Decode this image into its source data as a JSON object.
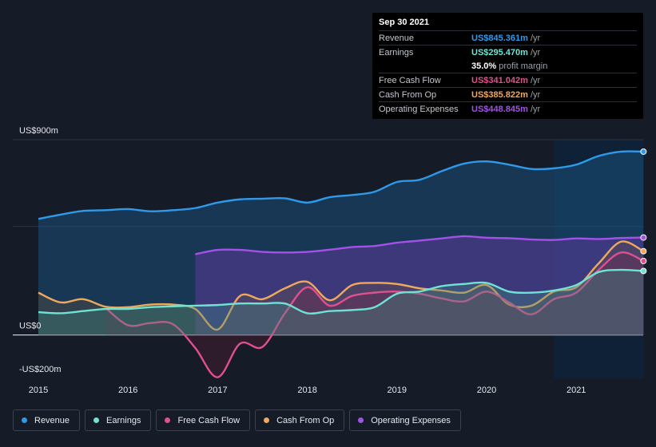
{
  "tooltip": {
    "date": "Sep 30 2021",
    "rows": [
      {
        "label": "Revenue",
        "value": "US$845.361m",
        "unit": "/yr",
        "color": "#2f9ae9"
      },
      {
        "label": "Earnings",
        "value": "US$295.470m",
        "unit": "/yr",
        "color": "#6fe3d3"
      },
      {
        "label": "",
        "value": "35.0%",
        "unit": "profit margin",
        "color": "#ffffff"
      },
      {
        "label": "Free Cash Flow",
        "value": "US$341.042m",
        "unit": "/yr",
        "color": "#e0508f"
      },
      {
        "label": "Cash From Op",
        "value": "US$385.822m",
        "unit": "/yr",
        "color": "#f0a95c"
      },
      {
        "label": "Operating Expenses",
        "value": "US$448.845m",
        "unit": "/yr",
        "color": "#a351e8"
      }
    ]
  },
  "legend": [
    {
      "label": "Revenue",
      "color": "#2f9ae9"
    },
    {
      "label": "Earnings",
      "color": "#6fe3d3"
    },
    {
      "label": "Free Cash Flow",
      "color": "#e0508f"
    },
    {
      "label": "Cash From Op",
      "color": "#f0a95c"
    },
    {
      "label": "Operating Expenses",
      "color": "#a351e8"
    }
  ],
  "chart_data": {
    "type": "line",
    "ylim": [
      -200,
      900
    ],
    "xlim": [
      2014.7,
      2021.75
    ],
    "y_tick_labels": [
      {
        "value": 900,
        "label": "US$900m"
      },
      {
        "value": 0,
        "label": "US$0"
      },
      {
        "value": -200,
        "label": "-US$200m"
      }
    ],
    "x_ticks": [
      2015,
      2016,
      2017,
      2018,
      2019,
      2020,
      2021
    ],
    "x_tick_labels": [
      "2015",
      "2016",
      "2017",
      "2018",
      "2019",
      "2020",
      "2021"
    ],
    "grid_values": [
      900,
      500,
      0
    ],
    "highlight_from": 2020.75,
    "series": [
      {
        "name": "Revenue",
        "color": "#2f9ae9",
        "fill": true,
        "x": [
          2015.0,
          2015.25,
          2015.5,
          2015.75,
          2016.0,
          2016.25,
          2016.5,
          2016.75,
          2017.0,
          2017.25,
          2017.5,
          2017.75,
          2018.0,
          2018.25,
          2018.5,
          2018.75,
          2019.0,
          2019.25,
          2019.5,
          2019.75,
          2020.0,
          2020.25,
          2020.5,
          2020.75,
          2021.0,
          2021.25,
          2021.5,
          2021.75
        ],
        "y": [
          535,
          555,
          572,
          575,
          580,
          570,
          575,
          585,
          610,
          625,
          628,
          630,
          610,
          635,
          645,
          660,
          705,
          715,
          755,
          790,
          800,
          785,
          765,
          768,
          785,
          825,
          845,
          845
        ]
      },
      {
        "name": "Operating Expenses",
        "color": "#a351e8",
        "fill": true,
        "x": [
          2016.75,
          2017.0,
          2017.25,
          2017.5,
          2017.75,
          2018.0,
          2018.25,
          2018.5,
          2018.75,
          2019.0,
          2019.25,
          2019.5,
          2019.75,
          2020.0,
          2020.25,
          2020.5,
          2020.75,
          2021.0,
          2021.25,
          2021.5,
          2021.75
        ],
        "y": [
          372,
          392,
          392,
          383,
          380,
          383,
          393,
          405,
          410,
          425,
          435,
          445,
          455,
          448,
          446,
          440,
          438,
          445,
          442,
          447,
          449
        ]
      },
      {
        "name": "Cash From Op",
        "color": "#f0a95c",
        "fill": false,
        "x": [
          2015.0,
          2015.25,
          2015.5,
          2015.75,
          2016.0,
          2016.25,
          2016.5,
          2016.75,
          2017.0,
          2017.25,
          2017.5,
          2017.75,
          2018.0,
          2018.25,
          2018.5,
          2018.75,
          2019.0,
          2019.25,
          2019.5,
          2019.75,
          2020.0,
          2020.25,
          2020.5,
          2020.75,
          2021.0,
          2021.25,
          2021.5,
          2021.75
        ],
        "y": [
          195,
          150,
          165,
          130,
          128,
          140,
          140,
          120,
          25,
          180,
          165,
          215,
          245,
          160,
          230,
          240,
          235,
          215,
          205,
          195,
          230,
          140,
          135,
          200,
          220,
          330,
          430,
          386
        ]
      },
      {
        "name": "Free Cash Flow",
        "color": "#e0508f",
        "fill": false,
        "x": [
          2015.75,
          2016.0,
          2016.25,
          2016.5,
          2016.75,
          2017.0,
          2017.25,
          2017.5,
          2017.75,
          2018.0,
          2018.25,
          2018.5,
          2018.75,
          2019.0,
          2019.25,
          2019.5,
          2019.75,
          2020.0,
          2020.25,
          2020.5,
          2020.75,
          2021.0,
          2021.25,
          2021.5,
          2021.75
        ],
        "y": [
          125,
          45,
          55,
          50,
          -60,
          -195,
          -40,
          -55,
          100,
          220,
          135,
          180,
          195,
          200,
          190,
          168,
          155,
          200,
          150,
          95,
          165,
          195,
          300,
          380,
          341
        ]
      },
      {
        "name": "Earnings",
        "color": "#6fe3d3",
        "fill": true,
        "x": [
          2015.0,
          2015.25,
          2015.5,
          2015.75,
          2016.0,
          2016.25,
          2016.5,
          2016.75,
          2017.0,
          2017.25,
          2017.5,
          2017.75,
          2018.0,
          2018.25,
          2018.5,
          2018.75,
          2019.0,
          2019.25,
          2019.5,
          2019.75,
          2020.0,
          2020.25,
          2020.5,
          2020.75,
          2021.0,
          2021.25,
          2021.5,
          2021.75
        ],
        "y": [
          105,
          100,
          110,
          120,
          120,
          128,
          132,
          135,
          138,
          145,
          145,
          145,
          100,
          110,
          115,
          128,
          190,
          200,
          225,
          235,
          240,
          200,
          195,
          205,
          230,
          290,
          300,
          295
        ]
      }
    ]
  }
}
